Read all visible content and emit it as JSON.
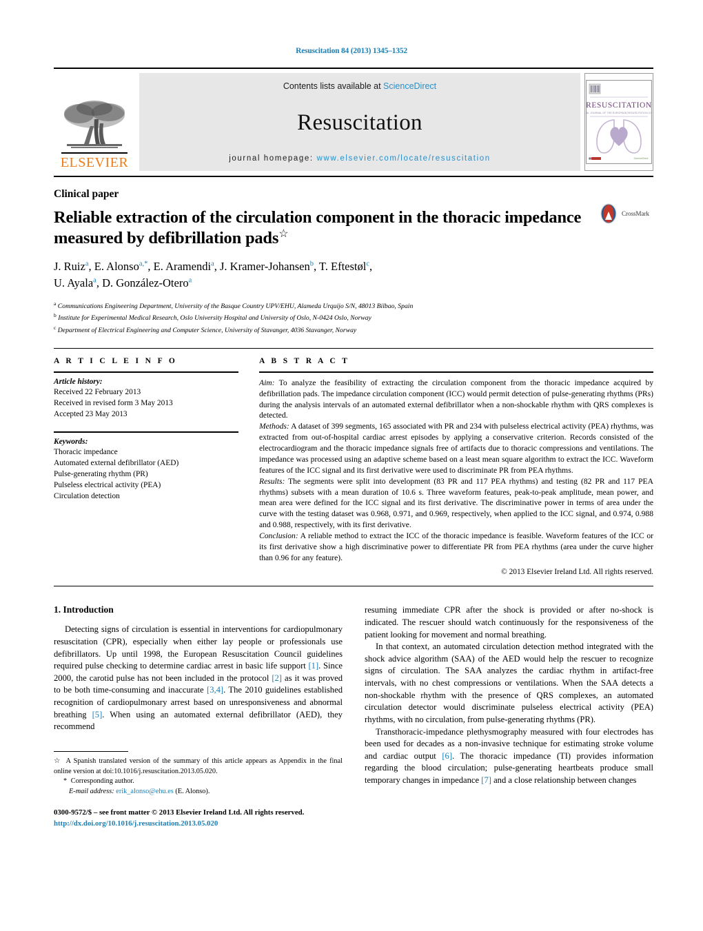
{
  "running_head": "Resuscitation 84 (2013) 1345–1352",
  "masthead": {
    "publisher_name": "ELSEVIER",
    "contents_prefix": "Contents lists available at ",
    "contents_link": "ScienceDirect",
    "journal_name": "Resuscitation",
    "homepage_prefix": "journal homepage: ",
    "homepage_url": "www.elsevier.com/locate/resuscitation",
    "cover_title": "RESUSCITATION",
    "cover_subtitle": "OFFICIAL JOURNAL OF THE EUROPEAN RESUSCITATION COUNCIL"
  },
  "article": {
    "kind": "Clinical paper",
    "title": "Reliable extraction of the circulation component in the thoracic impedance measured by defibrillation pads",
    "title_marker": "☆",
    "crossmark_label": "CrossMark",
    "authors_line1": "J. Ruiz",
    "authors": [
      {
        "name": "J. Ruiz",
        "sup": "a"
      },
      {
        "name": "E. Alonso",
        "sup": "a,*"
      },
      {
        "name": "E. Aramendi",
        "sup": "a"
      },
      {
        "name": "J. Kramer-Johansen",
        "sup": "b"
      },
      {
        "name": "T. Eftestøl",
        "sup": "c"
      },
      {
        "name": "U. Ayala",
        "sup": "a"
      },
      {
        "name": "D. González-Otero",
        "sup": "a"
      }
    ],
    "affiliations": [
      {
        "mark": "a",
        "text": "Communications Engineering Department, University of the Basque Country UPV/EHU, Alameda Urquijo S/N, 48013 Bilbao, Spain"
      },
      {
        "mark": "b",
        "text": "Institute for Experimental Medical Research, Oslo University Hospital and University of Oslo, N-0424 Oslo, Norway"
      },
      {
        "mark": "c",
        "text": "Department of Electrical Engineering and Computer Science, University of Stavanger, 4036 Stavanger, Norway"
      }
    ]
  },
  "article_info": {
    "heading": "A R T I C L E   I N F O",
    "history_label": "Article history:",
    "history": [
      "Received 22 February 2013",
      "Received in revised form 3 May 2013",
      "Accepted 23 May 2013"
    ],
    "keywords_label": "Keywords:",
    "keywords": [
      "Thoracic impedance",
      "Automated external defibrillator (AED)",
      "Pulse-generating rhythm (PR)",
      "Pulseless electrical activity (PEA)",
      "Circulation detection"
    ]
  },
  "abstract": {
    "heading": "A B S T R A C T",
    "aim_label": "Aim:",
    "aim_text": " To analyze the feasibility of extracting the circulation component from the thoracic impedance acquired by defibrillation pads. The impedance circulation component (ICC) would permit detection of pulse-generating rhythms (PRs) during the analysis intervals of an automated external defibrillator when a non-shockable rhythm with QRS complexes is detected.",
    "methods_label": "Methods:",
    "methods_text": " A dataset of 399 segments, 165 associated with PR and 234 with pulseless electrical activity (PEA) rhythms, was extracted from out-of-hospital cardiac arrest episodes by applying a conservative criterion. Records consisted of the electrocardiogram and the thoracic impedance signals free of artifacts due to thoracic compressions and ventilations. The impedance was processed using an adaptive scheme based on a least mean square algorithm to extract the ICC. Waveform features of the ICC signal and its first derivative were used to discriminate PR from PEA rhythms.",
    "results_label": "Results:",
    "results_text": " The segments were split into development (83 PR and 117 PEA rhythms) and testing (82 PR and 117 PEA rhythms) subsets with a mean duration of 10.6 s. Three waveform features, peak-to-peak amplitude, mean power, and mean area were defined for the ICC signal and its first derivative. The discriminative power in terms of area under the curve with the testing dataset was 0.968, 0.971, and 0.969, respectively, when applied to the ICC signal, and 0.974, 0.988 and 0.988, respectively, with its first derivative.",
    "conclusion_label": "Conclusion:",
    "conclusion_text": " A reliable method to extract the ICC of the thoracic impedance is feasible. Waveform features of the ICC or its first derivative show a high discriminative power to differentiate PR from PEA rhythms (area under the curve higher than 0.96 for any feature).",
    "copyright": "© 2013 Elsevier Ireland Ltd. All rights reserved."
  },
  "introduction": {
    "heading": "1. Introduction",
    "left_paragraphs": [
      "Detecting signs of circulation is essential in interventions for cardiopulmonary resuscitation (CPR), especially when either lay people or professionals use defibrillators. Up until 1998, the European Resuscitation Council guidelines required pulse checking to determine cardiac arrest in basic life support [1]. Since 2000, the carotid pulse has not been included in the protocol [2] as it was proved to be both time-consuming and inaccurate [3,4]. The 2010 guidelines established recognition of cardiopulmonary arrest based on unresponsiveness and abnormal breathing [5]. When using an automated external defibrillator (AED), they recommend"
    ],
    "right_paragraphs": [
      "resuming immediate CPR after the shock is provided or after no-shock is indicated. The rescuer should watch continuously for the responsiveness of the patient looking for movement and normal breathing.",
      "In that context, an automated circulation detection method integrated with the shock advice algorithm (SAA) of the AED would help the rescuer to recognize signs of circulation. The SAA analyzes the cardiac rhythm in artifact-free intervals, with no chest compressions or ventilations. When the SAA detects a non-shockable rhythm with the presence of QRS complexes, an automated circulation detector would discriminate pulseless electrical activity (PEA) rhythms, with no circulation, from pulse-generating rhythms (PR).",
      "Transthoracic-impedance plethysmography measured with four electrodes has been used for decades as a non-invasive technique for estimating stroke volume and cardiac output [6]. The thoracic impedance (TI) provides information regarding the blood circulation; pulse-generating heartbeats produce small temporary changes in impedance [7] and a close relationship between changes"
    ]
  },
  "footnotes": {
    "star_mark": "☆",
    "star_text": " A Spanish translated version of the summary of this article appears as Appendix in the final online version at doi:10.1016/j.resuscitation.2013.05.020.",
    "corresponding_mark": "*",
    "corresponding_text": " Corresponding author.",
    "email_label": "E-mail address:",
    "email": "erik_alonso@ehu.es",
    "email_owner": " (E. Alonso).",
    "issn_line": "0300-9572/$ – see front matter © 2013 Elsevier Ireland Ltd. All rights reserved.",
    "doi_url": "http://dx.doi.org/10.1016/j.resuscitation.2013.05.020"
  },
  "colors": {
    "link_blue": "#1a7fb5",
    "sciencedirect_blue": "#2a8fc7",
    "elsevier_orange": "#ef7c1a",
    "band_gray": "#e7e7e7"
  }
}
